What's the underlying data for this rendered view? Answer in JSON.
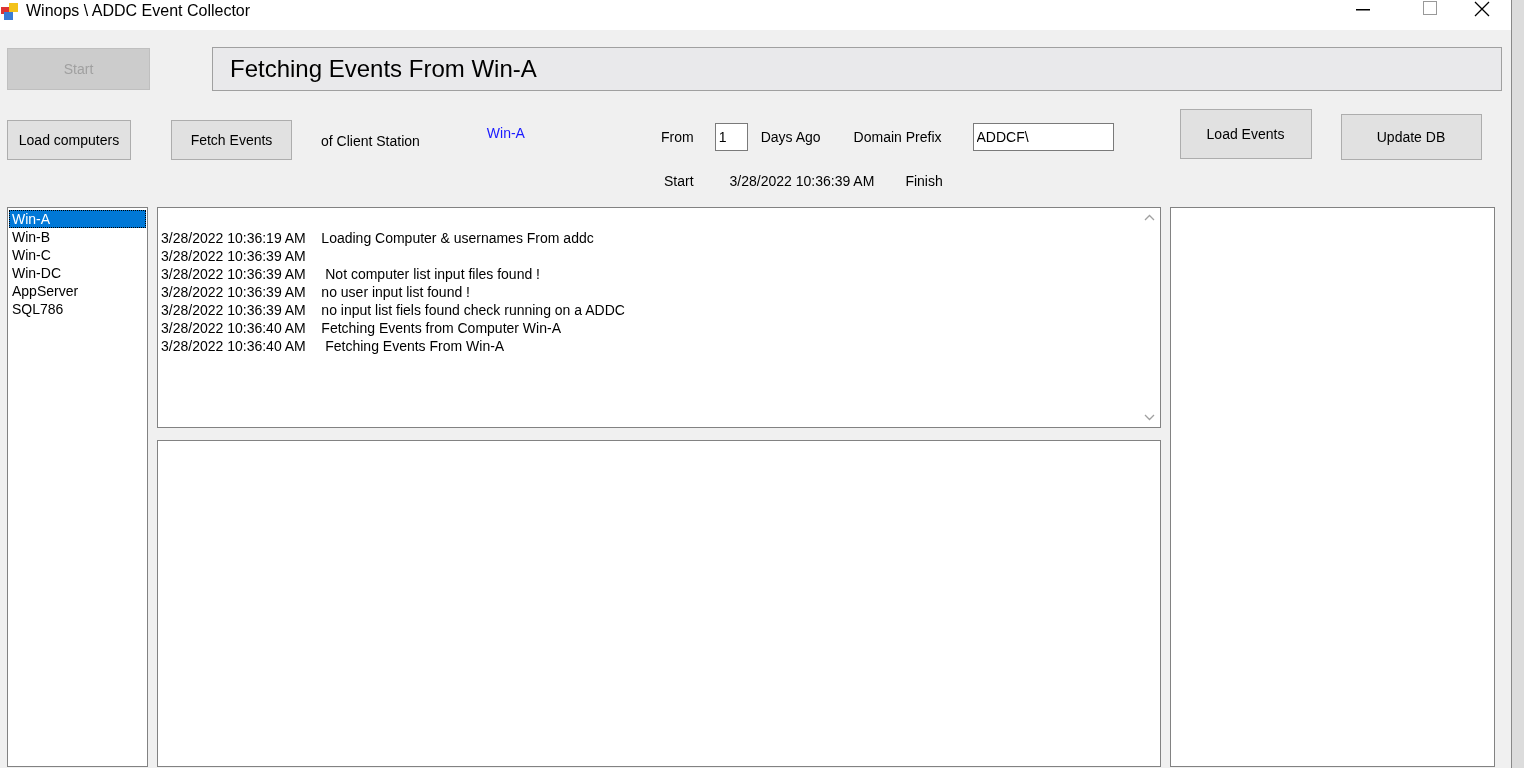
{
  "window": {
    "title": "Winops \\ ADDC Event Collector"
  },
  "start_button": {
    "label": "Start",
    "disabled": true
  },
  "status_text": "Fetching Events From Win-A",
  "toolbar": {
    "load_computers": "Load computers",
    "fetch_events": "Fetch Events",
    "client_label": "of Client Station",
    "client_value": "Win-A",
    "from_label": "From",
    "days_value": "1",
    "days_label": "Days Ago",
    "domain_label": "Domain Prefix",
    "domain_value": "ADDCF\\",
    "load_events": "Load Events",
    "update_db": "Update DB"
  },
  "timing": {
    "start_label": "Start",
    "start_value": "3/28/2022 10:36:39 AM",
    "finish_label": "Finish"
  },
  "computers": [
    {
      "name": "Win-A",
      "selected": true
    },
    {
      "name": "Win-B",
      "selected": false
    },
    {
      "name": "Win-C",
      "selected": false
    },
    {
      "name": "Win-DC",
      "selected": false
    },
    {
      "name": "AppServer",
      "selected": false
    },
    {
      "name": "SQL786",
      "selected": false
    }
  ],
  "log_lines": [
    "3/28/2022 10:36:19 AM    Loading Computer & usernames From addc",
    "3/28/2022 10:36:39 AM",
    "3/28/2022 10:36:39 AM     Not computer list input files found !",
    "3/28/2022 10:36:39 AM    no user input list found !",
    "3/28/2022 10:36:39 AM    no input list fiels found check running on a ADDC",
    "3/28/2022 10:36:40 AM    Fetching Events from Computer Win-A",
    "3/28/2022 10:36:40 AM     Fetching Events From Win-A"
  ]
}
